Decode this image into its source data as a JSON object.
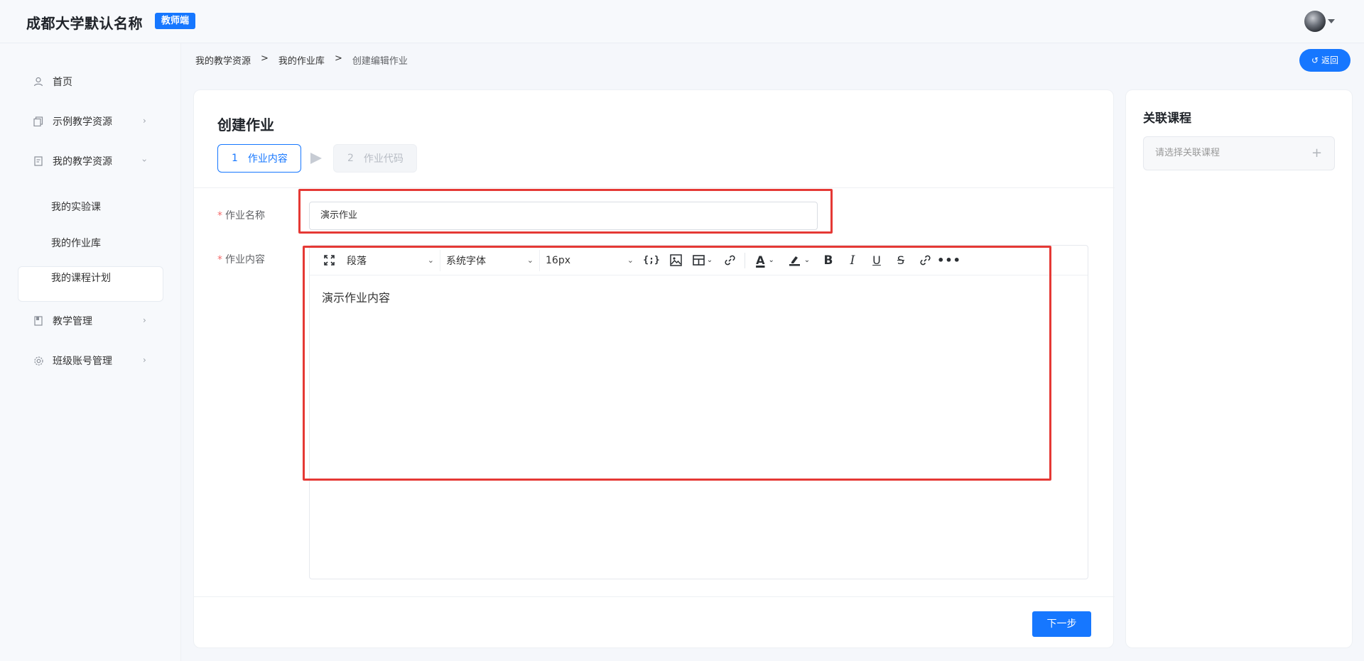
{
  "header": {
    "brand": "成都大学默认名称",
    "role_badge": "教师端"
  },
  "sidebar": {
    "items": [
      {
        "label": "首页",
        "icon": "user-icon"
      },
      {
        "label": "示例教学资源",
        "icon": "copy-icon"
      },
      {
        "label": "我的教学资源",
        "icon": "document-icon"
      },
      {
        "label": "教学管理",
        "icon": "book-icon"
      },
      {
        "label": "班级账号管理",
        "icon": "gear-icon"
      }
    ],
    "subitems": [
      {
        "label": "我的实验课"
      },
      {
        "label": "我的作业库",
        "active": true
      },
      {
        "label": "我的课程计划"
      }
    ]
  },
  "breadcrumb": {
    "items": [
      "我的教学资源",
      "我的作业库",
      "创建编辑作业"
    ],
    "separator": ">"
  },
  "back_button": "返回",
  "main": {
    "title": "创建作业",
    "steps": [
      {
        "num": "1",
        "label": "作业内容",
        "active": true
      },
      {
        "num": "2",
        "label": "作业代码",
        "active": false
      }
    ],
    "name_label": "作业名称",
    "name_value": "演示作业",
    "content_label": "作业内容",
    "required_mark": "*",
    "toolbar": {
      "paragraph": "段落",
      "font": "系统字体",
      "size": "16px"
    },
    "content_text": "演示作业内容",
    "next_button": "下一步"
  },
  "side": {
    "title": "关联课程",
    "placeholder": "请选择关联课程",
    "plus": "+"
  },
  "colors": {
    "primary": "#1677ff",
    "highlight": "#e53935"
  }
}
